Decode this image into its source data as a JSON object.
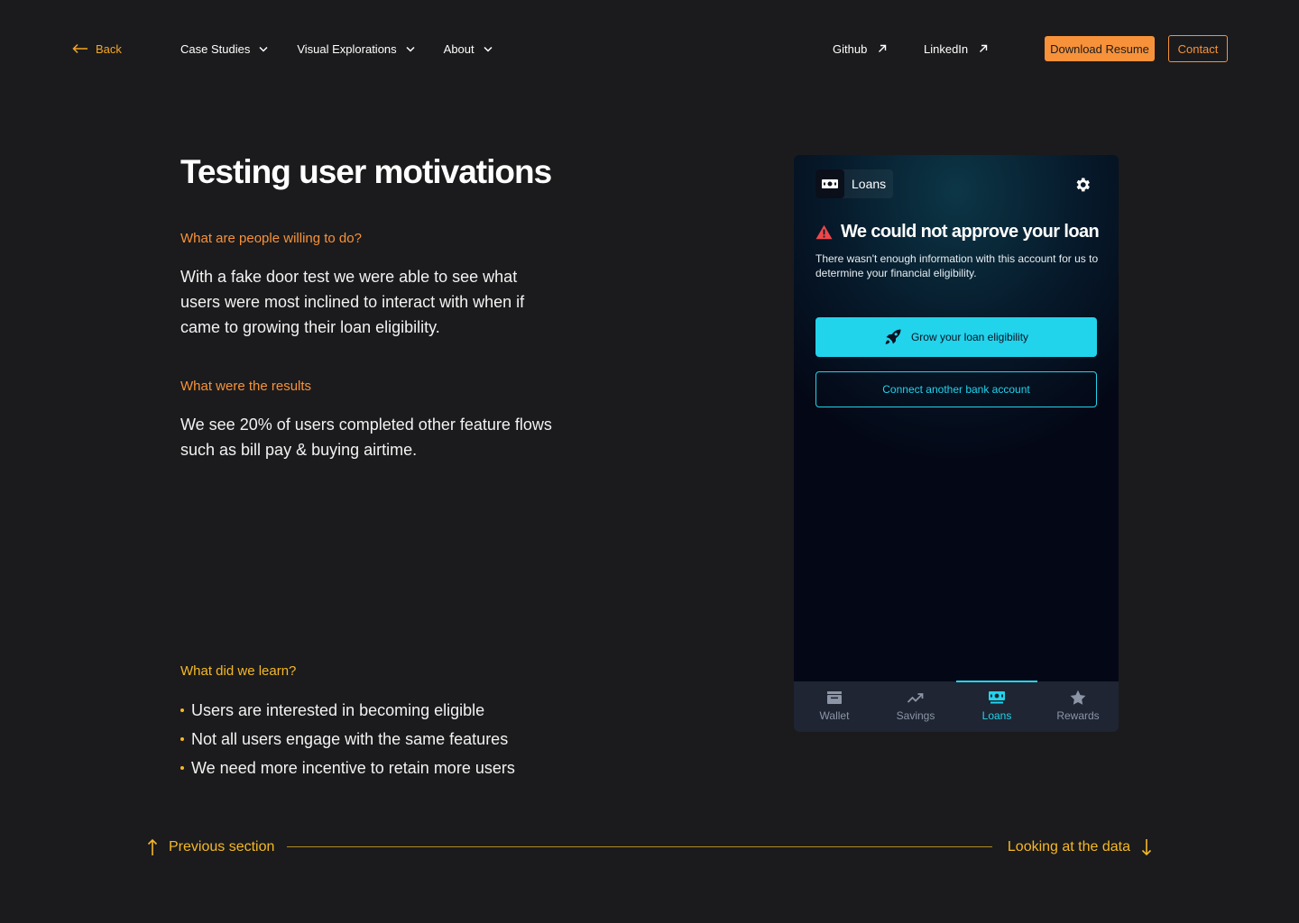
{
  "nav": {
    "back_label": "Back",
    "menu": [
      {
        "label": "Case Studies"
      },
      {
        "label": "Visual Explorations"
      },
      {
        "label": "About"
      }
    ],
    "github_label": "Github",
    "linkedin_label": "LinkedIn",
    "resume_label": "Download Resume",
    "contact_label": "Contact"
  },
  "content": {
    "title": "Testing user motivations",
    "q1": "What are people willing to do?",
    "p1": "With a fake door test we were able to see what users were most inclined to interact with when if came to growing their loan eligibility.",
    "q2": "What were the results",
    "p2": "We see 20% of users completed other feature flows such as bill pay & buying airtime.",
    "q3": "What did we learn?",
    "learnings": [
      "Users are interested in becoming eligible",
      "Not all users engage with the same features",
      "We need more incentive to retain more users"
    ]
  },
  "phone": {
    "header_label": "Loans",
    "alert_title": "We could not approve your loan",
    "alert_desc": "There wasn't enough information with this account for us to determine your financial eligibility.",
    "grow_label": "Grow your loan eligibility",
    "connect_label": "Connect another bank account",
    "tabs": [
      {
        "label": "Wallet",
        "icon": "wallet-icon"
      },
      {
        "label": "Savings",
        "icon": "trend-up-icon"
      },
      {
        "label": "Loans",
        "icon": "banknote-icon",
        "active": true
      },
      {
        "label": "Rewards",
        "icon": "star-icon"
      }
    ],
    "accent": "#22d3ec",
    "alert_color": "#f0474a"
  },
  "footer": {
    "prev_label": "Previous section",
    "next_label": "Looking at the data"
  },
  "colors": {
    "background": "#1b1b1d",
    "orange": "#f7923a",
    "yellow": "#f5b826"
  }
}
